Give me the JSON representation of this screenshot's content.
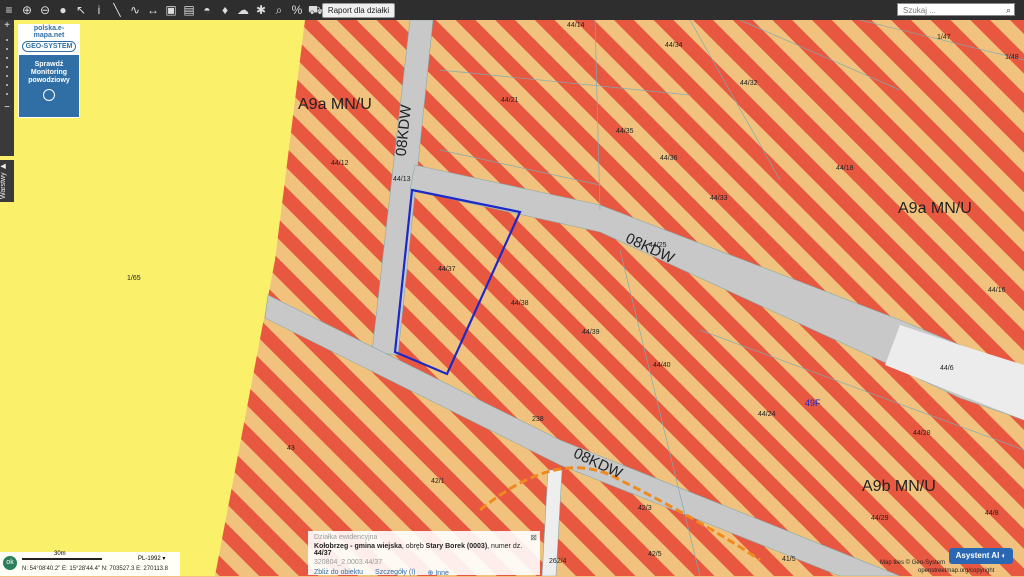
{
  "toolbar": {
    "report_label": "Raport dla działki",
    "search_placeholder": "Szukaj ..."
  },
  "sidebar": {
    "tab_label": "Warstwy"
  },
  "geo_panel": {
    "brand": "polska.e-mapa.net",
    "logo": "GEO-SYSTEM",
    "line1": "Sprawdź",
    "line2": "Monitoring",
    "line3": "powodziowy"
  },
  "map": {
    "zones": [
      "A9a MN/U",
      "A9a MN/U",
      "A9b MN/U"
    ],
    "roads": [
      "08KDW",
      "08KDW",
      "08KDW"
    ],
    "parcels": [
      "44/14",
      "44/34",
      "1/47",
      "1/48",
      "44/32",
      "44/21",
      "44/35",
      "44/36",
      "44/12",
      "44/13",
      "44/33",
      "44/18",
      "44/37",
      "44/25",
      "44/38",
      "1/65",
      "44/39",
      "44/16",
      "44/40",
      "44/6",
      "44/24",
      "44/28",
      "238",
      "43",
      "42/1",
      "42/3",
      "42/5",
      "262/4",
      "44/29",
      "44/8",
      "41/5",
      "49F"
    ]
  },
  "info": {
    "title": "Działka ewidencyjna",
    "line_prefix": "Kołobrzeg - gmina wiejska",
    "line_mid": ", obręb ",
    "line_obreb": "Stary Borek (0003)",
    "line_suffix": ", numer dz.",
    "line_num": "44/37",
    "id": "320804_2.0003.44/37",
    "link1": "Zbliż do obiektu",
    "link2": "Szczegóły (I)",
    "link3": "Inne"
  },
  "status": {
    "ok": "ok",
    "scale": "30m",
    "crs": "PL-1992",
    "coords": "N: 54°08'40.2\"  E: 15°28'44.4\"   N: 703527.3   E: 270113.8"
  },
  "asystent": "Asystent AI",
  "attribution1": "Map tiles © Geo-System",
  "attribution2": "openstreetmap.org/copyright"
}
